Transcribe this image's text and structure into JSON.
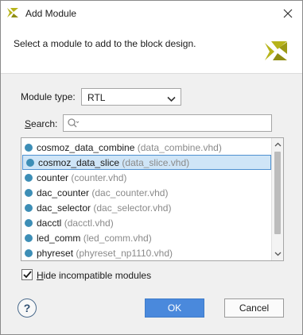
{
  "window": {
    "title": "Add Module",
    "close_icon": "close-icon",
    "app_icon": "vivado-logo-icon"
  },
  "header": {
    "description": "Select a module to add to the block design.",
    "logo_icon": "vivado-logo-icon"
  },
  "module_type": {
    "label": "Module type:",
    "value": "RTL",
    "icon": "chevron-down-icon"
  },
  "search": {
    "label_underlined": "S",
    "label_rest": "earch:",
    "placeholder": "",
    "icon": "search-icon"
  },
  "modules": {
    "items": [
      {
        "name": "cosmoz_data_combine",
        "file": "(data_combine.vhd)",
        "selected": false
      },
      {
        "name": "cosmoz_data_slice",
        "file": "(data_slice.vhd)",
        "selected": true
      },
      {
        "name": "counter",
        "file": "(counter.vhd)",
        "selected": false
      },
      {
        "name": "dac_counter",
        "file": "(dac_counter.vhd)",
        "selected": false
      },
      {
        "name": "dac_selector",
        "file": "(dac_selector.vhd)",
        "selected": false
      },
      {
        "name": "dacctl",
        "file": "(dacctl.vhd)",
        "selected": false
      },
      {
        "name": "led_comm",
        "file": "(led_comm.vhd)",
        "selected": false
      },
      {
        "name": "phyreset",
        "file": "(phyreset_np1110.vhd)",
        "selected": false
      }
    ],
    "item_icon": "module-dot-icon"
  },
  "hide_incompatible": {
    "label_underlined": "H",
    "label_rest": "ide incompatible modules",
    "checked": true
  },
  "footer": {
    "help_label": "?",
    "ok_label": "OK",
    "cancel_label": "Cancel"
  },
  "colors": {
    "accent": "#4a89dc",
    "selection": "#cfe5f7",
    "module_dot": "#3d8eb6",
    "logo": "#b7b41a"
  }
}
